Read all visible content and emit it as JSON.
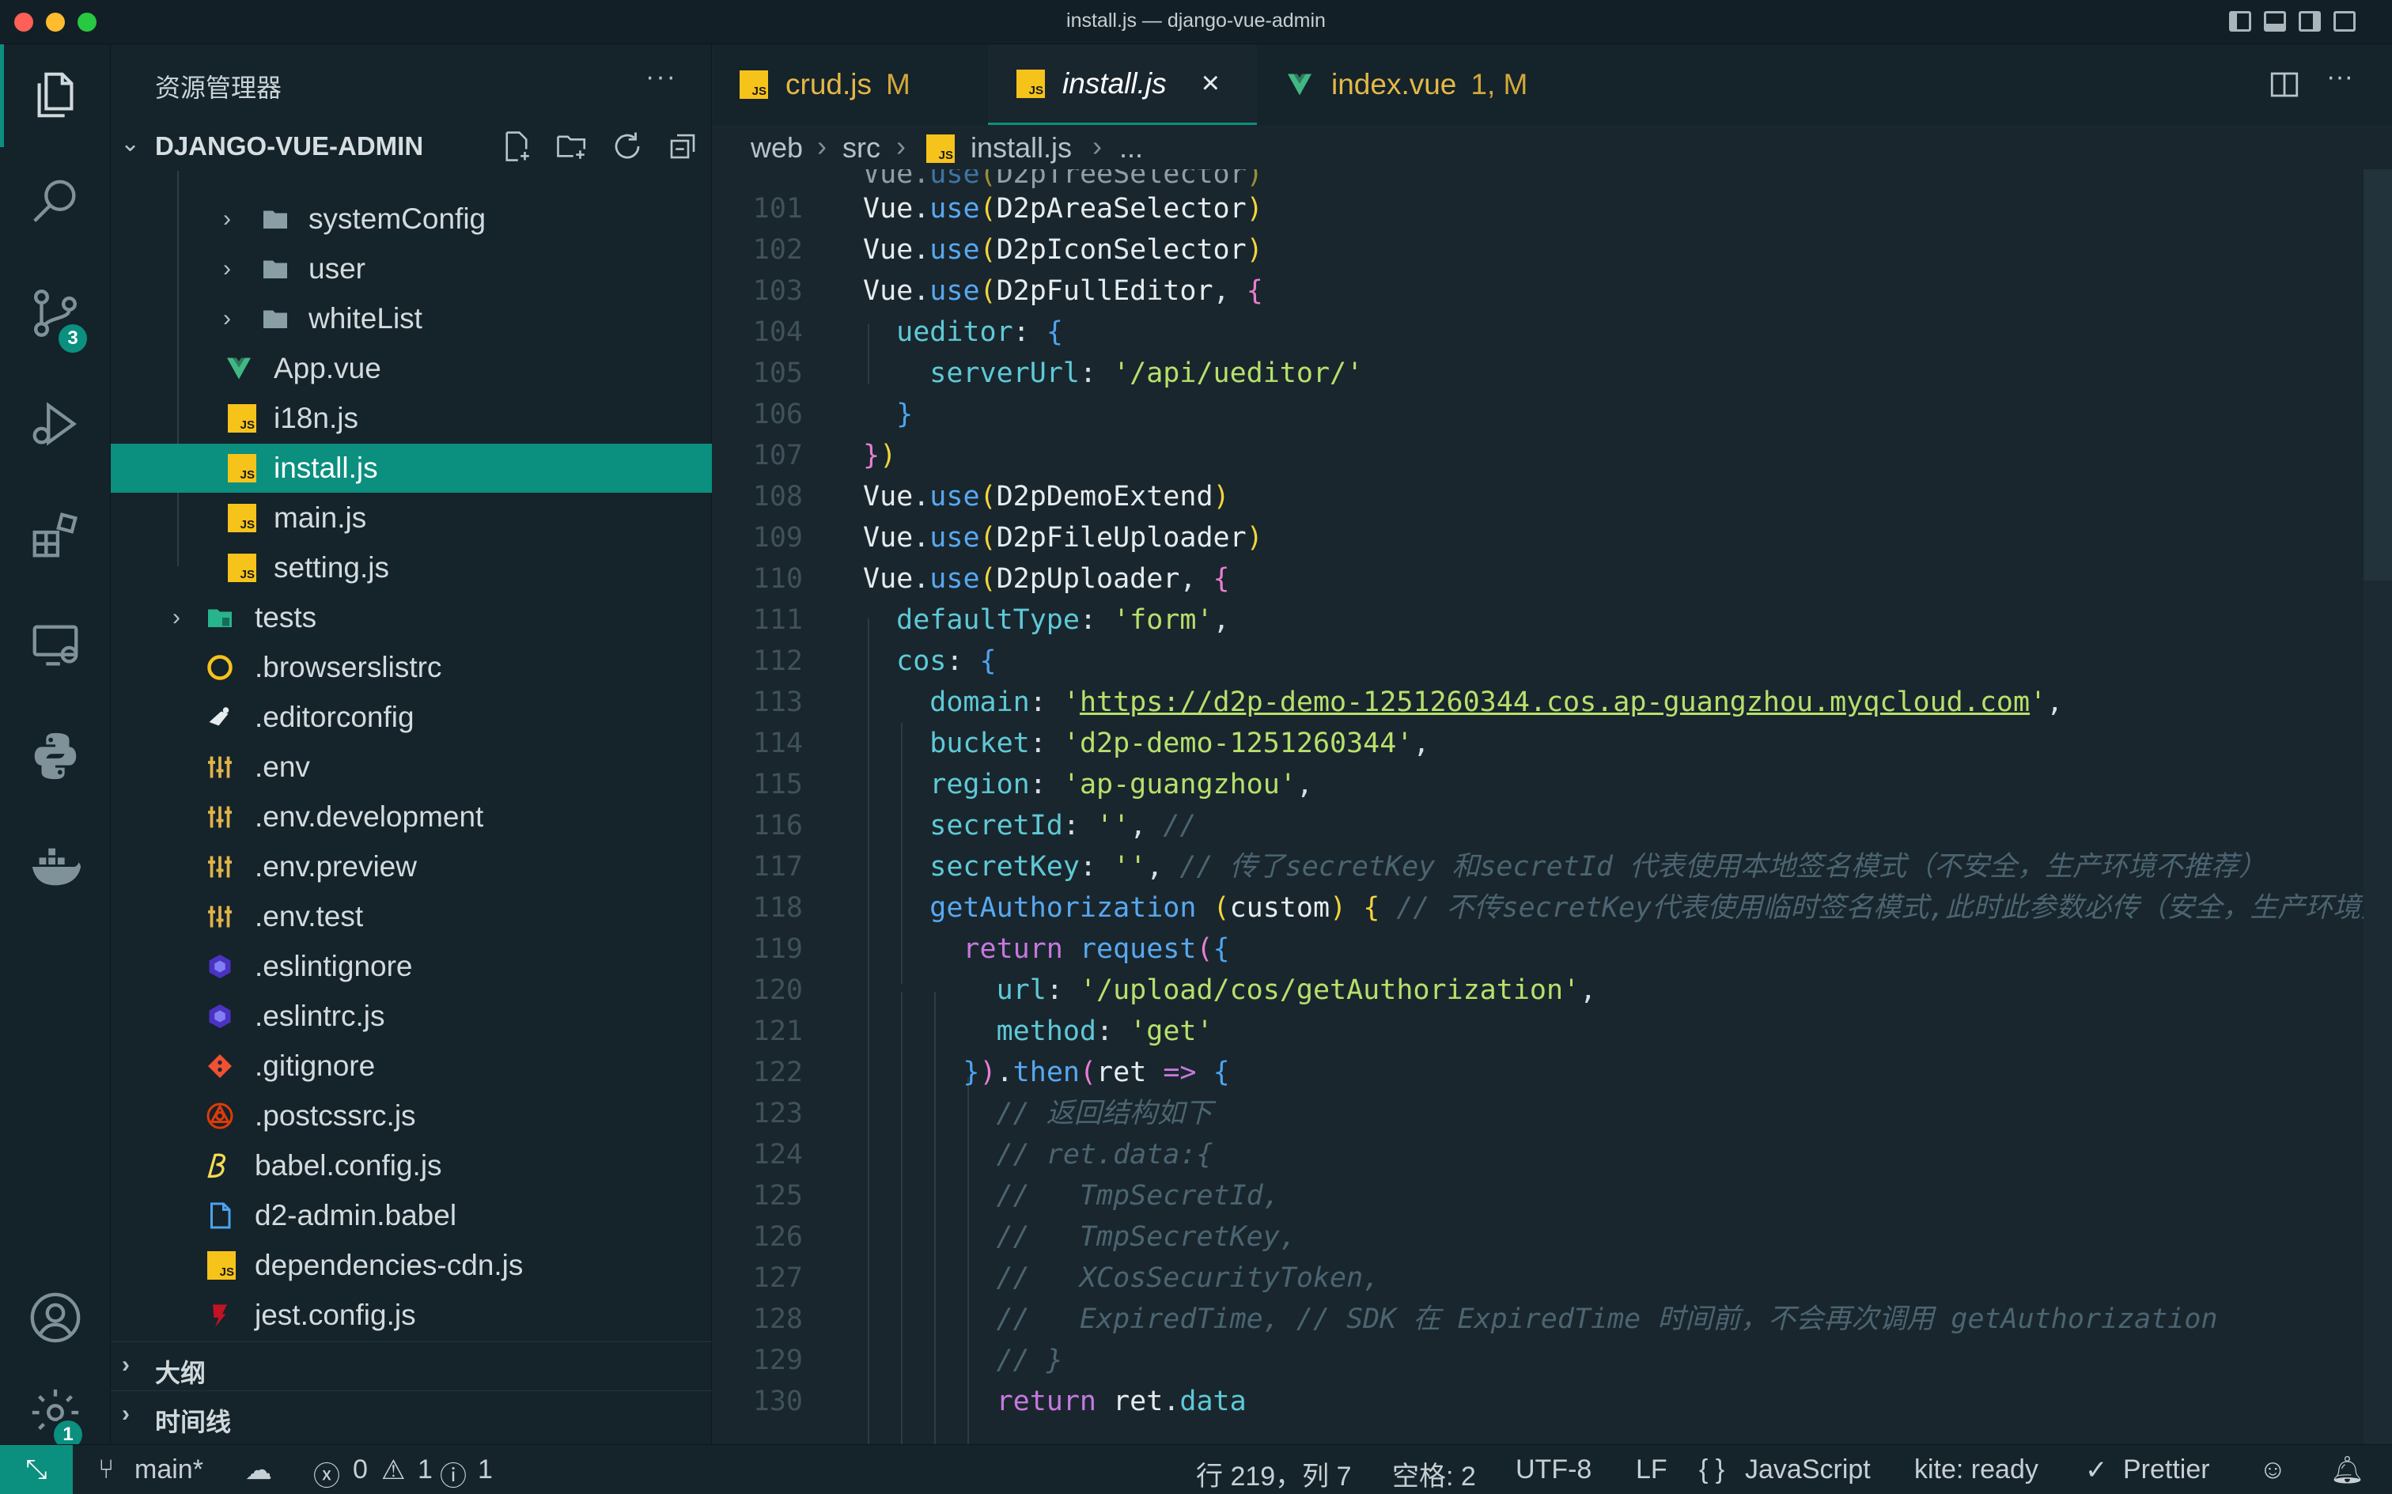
{
  "window": {
    "title": "install.js — django-vue-admin"
  },
  "activity": {
    "scm_badge": "3",
    "settings_badge": "1"
  },
  "sidebar": {
    "title": "资源管理器",
    "more": "···",
    "project": "DJANGO-VUE-ADMIN",
    "items": [
      {
        "label": "systemConfig",
        "icon": "folder-icon"
      },
      {
        "label": "user",
        "icon": "folder-icon"
      },
      {
        "label": "whiteList",
        "icon": "folder-icon"
      },
      {
        "label": "App.vue",
        "icon": "vue-icon"
      },
      {
        "label": "i18n.js",
        "icon": "js-icon"
      },
      {
        "label": "install.js",
        "icon": "js-icon"
      },
      {
        "label": "main.js",
        "icon": "js-icon"
      },
      {
        "label": "setting.js",
        "icon": "js-icon"
      },
      {
        "label": "tests",
        "icon": "test-folder-icon"
      },
      {
        "label": ".browserslistrc",
        "icon": "browserslist-icon"
      },
      {
        "label": ".editorconfig",
        "icon": "editorconfig-icon"
      },
      {
        "label": ".env",
        "icon": "env-icon"
      },
      {
        "label": ".env.development",
        "icon": "env-icon"
      },
      {
        "label": ".env.preview",
        "icon": "env-icon"
      },
      {
        "label": ".env.test",
        "icon": "env-icon"
      },
      {
        "label": ".eslintignore",
        "icon": "eslint-icon"
      },
      {
        "label": ".eslintrc.js",
        "icon": "eslint-icon"
      },
      {
        "label": ".gitignore",
        "icon": "git-icon"
      },
      {
        "label": ".postcssrc.js",
        "icon": "postcss-icon"
      },
      {
        "label": "babel.config.js",
        "icon": "babel-icon"
      },
      {
        "label": "d2-admin.babel",
        "icon": "file-icon"
      },
      {
        "label": "dependencies-cdn.js",
        "icon": "js-icon"
      },
      {
        "label": "jest.config.js",
        "icon": "jest-icon"
      }
    ],
    "js_badge": "JS",
    "outline": "大纲",
    "timeline": "时间线"
  },
  "tabs": [
    {
      "label": "crud.js",
      "mod": "M"
    },
    {
      "label": "install.js",
      "mod": ""
    },
    {
      "label": "index.vue",
      "mod": "1, M"
    }
  ],
  "breadcrumb": {
    "p1": "web",
    "p2": "src",
    "p3": "install.js",
    "p4": "..."
  },
  "code": {
    "line_numbers": [
      "101",
      "102",
      "103",
      "104",
      "105",
      "106",
      "107",
      "108",
      "109",
      "110",
      "111",
      "112",
      "113",
      "114",
      "115",
      "116",
      "117",
      "118",
      "119",
      "120",
      "121",
      "122",
      "123",
      "124",
      "125",
      "126",
      "127",
      "128",
      "129",
      "130"
    ],
    "comments": {
      "c117": "// 传了secretKey 和secretId 代表使用本地签名模式（不安全，生产环境不推荐）",
      "c118": "// 不传secretKey代表使用临时签名模式,此时此参数必传（安全，生产环境推荐",
      "c123": "// 返回结构如下",
      "c124": "// ret.data:{",
      "c125": "//   TmpSecretId,",
      "c126": "//   TmpSecretKey,",
      "c127": "//   XCosSecurityToken,",
      "c128": "//   ExpiredTime, // SDK 在 ExpiredTime 时间前，不会再次调用 getAuthorization",
      "c129": "// }"
    },
    "strings": {
      "s105": "'/api/ueditor/'",
      "s111": "'form'",
      "url113": "https://d2p-demo-1251260344.cos.ap-guangzhou.myqcloud.com",
      "s114": "'d2p-demo-1251260344'",
      "s115": "'ap-guangzhou'",
      "s120": "'/upload/cos/getAuthorization'",
      "s121": "'get'"
    }
  },
  "status": {
    "branch": "main*",
    "errors": "0",
    "warnings": "1",
    "info": "1",
    "position": "行 219，列 7",
    "spaces": "空格: 2",
    "encoding": "UTF-8",
    "eol": "LF",
    "language": "JavaScript",
    "kite": "kite: ready",
    "prettier": "Prettier"
  }
}
